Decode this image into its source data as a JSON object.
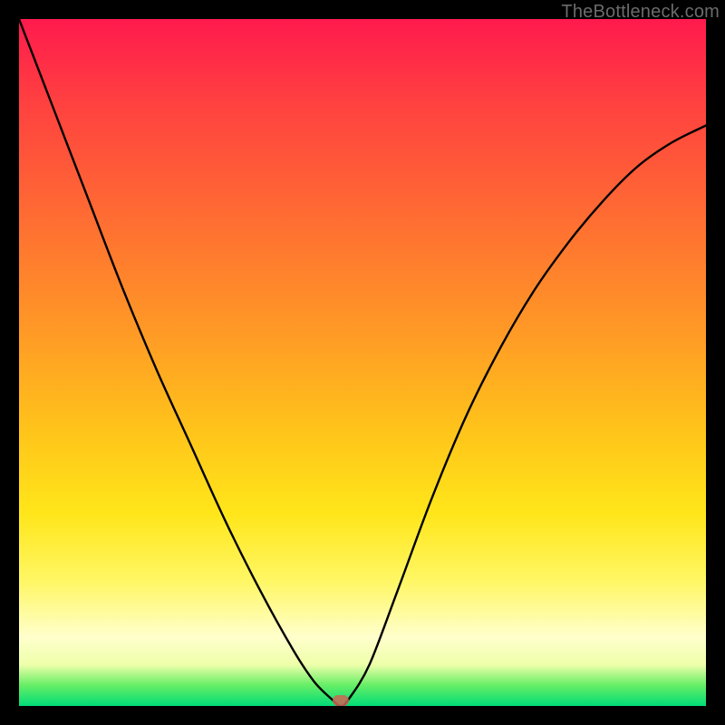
{
  "watermark": "TheBottleneck.com",
  "minimum_marker": {
    "x_frac": 0.468,
    "y_frac": 0.992
  },
  "chart_data": {
    "type": "line",
    "title": "",
    "xlabel": "",
    "ylabel": "",
    "xlim": [
      0,
      1
    ],
    "ylim": [
      0,
      1
    ],
    "legend": false,
    "grid": false,
    "annotations": [
      "TheBottleneck.com"
    ],
    "background_gradient": {
      "direction": "vertical",
      "stops": [
        {
          "pos": 0.0,
          "color": "#ff1a4d"
        },
        {
          "pos": 0.28,
          "color": "#ff6a33"
        },
        {
          "pos": 0.6,
          "color": "#ffc41a"
        },
        {
          "pos": 0.82,
          "color": "#fff766"
        },
        {
          "pos": 0.94,
          "color": "#eeffaa"
        },
        {
          "pos": 1.0,
          "color": "#00dd77"
        }
      ]
    },
    "series": [
      {
        "name": "bottleneck-curve",
        "color": "#000000",
        "x": [
          0.0,
          0.05,
          0.1,
          0.15,
          0.2,
          0.25,
          0.3,
          0.35,
          0.4,
          0.43,
          0.455,
          0.468,
          0.48,
          0.51,
          0.55,
          0.6,
          0.65,
          0.7,
          0.75,
          0.8,
          0.85,
          0.9,
          0.95,
          1.0
        ],
        "y": [
          1.0,
          0.87,
          0.74,
          0.61,
          0.49,
          0.38,
          0.27,
          0.17,
          0.08,
          0.035,
          0.01,
          0.0,
          0.01,
          0.06,
          0.165,
          0.3,
          0.42,
          0.52,
          0.605,
          0.675,
          0.735,
          0.785,
          0.82,
          0.845
        ]
      }
    ],
    "marker": {
      "name": "optimal-point",
      "x": 0.468,
      "y": 0.0,
      "shape": "oval",
      "color": "#cc6655"
    }
  }
}
